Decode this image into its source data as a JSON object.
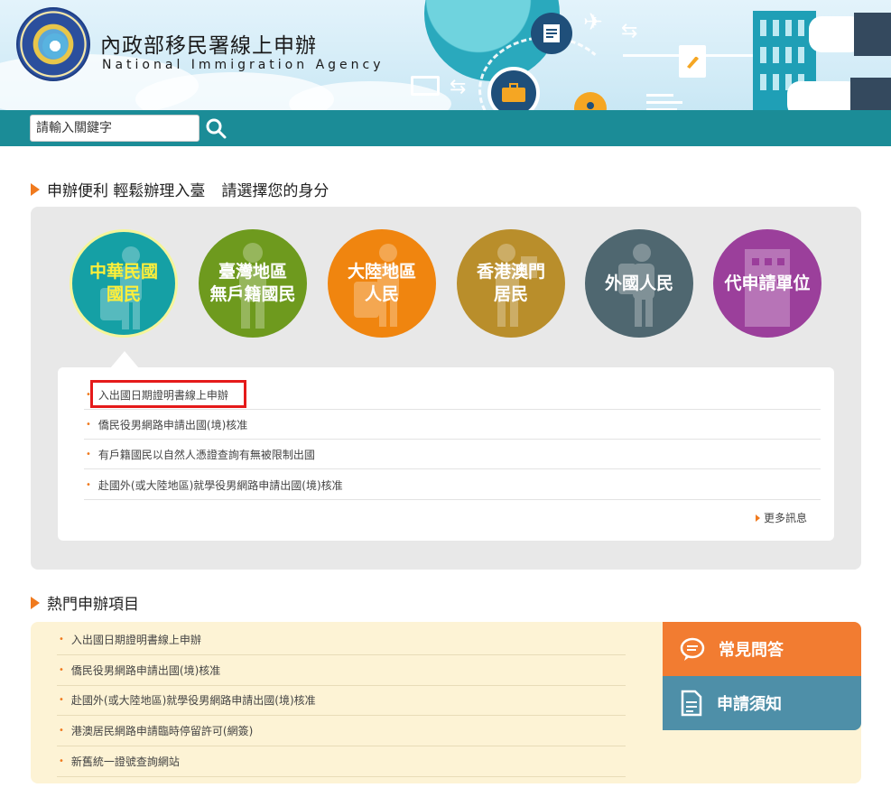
{
  "header": {
    "title": "內政部移民署線上申辦",
    "subtitle": "National Immigration Agency",
    "logo_text": "National Immigration Agency",
    "search_placeholder": "請輸入關鍵字",
    "search_icon": "search-icon"
  },
  "identity": {
    "title": "申辦便利 輕鬆辦理入臺",
    "prompt": "請選擇您的身分",
    "options": [
      {
        "line1": "中華民國",
        "line2": "國民",
        "color": "#15a0a5",
        "active": true,
        "icon": "traveler-icon"
      },
      {
        "line1": "臺灣地區",
        "line2": "無戶籍國民",
        "color": "#6e9a1e",
        "active": false,
        "icon": "person-icon"
      },
      {
        "line1": "大陸地區",
        "line2": "人民",
        "color": "#f0850f",
        "active": false,
        "icon": "luggage-icon"
      },
      {
        "line1": "香港澳門",
        "line2": "居民",
        "color": "#b98e2b",
        "active": false,
        "icon": "passport-icon"
      },
      {
        "line1": "外國人民",
        "line2": "",
        "color": "#4f6770",
        "active": false,
        "icon": "backpacker-icon"
      },
      {
        "line1": "代申請單位",
        "line2": "",
        "color": "#9b3f9b",
        "active": false,
        "icon": "building-icon"
      }
    ],
    "items": [
      "入出國日期證明書線上申辦",
      "僑民役男網路申請出國(境)核准",
      "有戶籍國民以自然人憑證查詢有無被限制出國",
      "赴國外(或大陸地區)就學役男網路申請出國(境)核准"
    ],
    "more_label": "更多訊息"
  },
  "popular": {
    "title": "熱門申辦項目",
    "items": [
      "入出國日期證明書線上申辦",
      "僑民役男網路申請出國(境)核准",
      "赴國外(或大陸地區)就學役男網路申請出國(境)核准",
      "港澳居民網路申請臨時停留許可(網簽)",
      "新舊統一證號查詢網站"
    ],
    "faq_label": "常見問答",
    "notice_label": "申請須知",
    "faq_color": "#f27c31",
    "notice_color": "#4e8fa8"
  },
  "colors": {
    "accent": "#f07a1e",
    "header_band": "#1b8c97",
    "highlight": "#e51a1a"
  }
}
